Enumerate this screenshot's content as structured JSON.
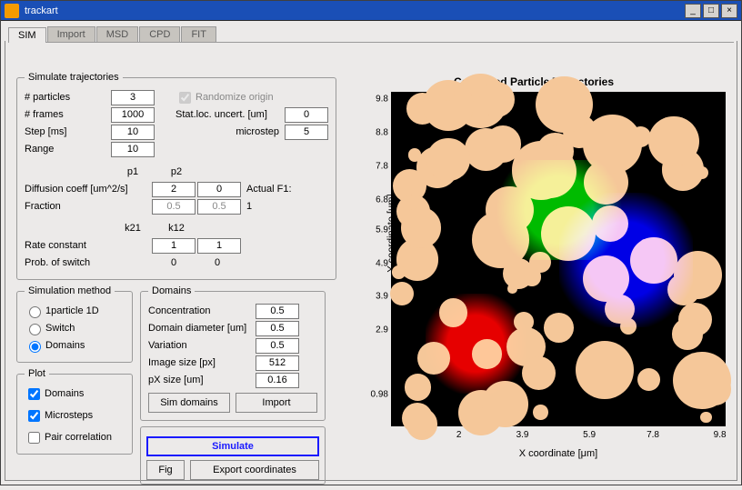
{
  "window": {
    "title": "trackart"
  },
  "tabs": [
    "SIM",
    "Import",
    "MSD",
    "CPD",
    "FIT"
  ],
  "activeTab": 0,
  "panels": {
    "simTraj": {
      "legend": "Simulate trajectories",
      "nparticles_label": "# particles",
      "nparticles": "3",
      "nframes_label": "# frames",
      "nframes": "1000",
      "step_label": "Step [ms]",
      "step": "10",
      "range_label": "Range",
      "range": "10",
      "rand_label": "Randomize origin",
      "stat_label": "Stat.loc. uncert. [um]",
      "stat": "0",
      "micro_label": "microstep",
      "micro": "5",
      "p1": "p1",
      "p2": "p2",
      "diff_label": "Diffusion coeff [um^2/s]",
      "diff_p1": "2",
      "diff_p2": "0",
      "af1_label": "Actual F1:",
      "af1_val": "1",
      "frac_label": "Fraction",
      "frac_p1": "0.5",
      "frac_p2": "0.5",
      "k21": "k21",
      "k12": "k12",
      "rate_label": "Rate constant",
      "rate_k21": "1",
      "rate_k12": "1",
      "psw_label": "Prob. of switch",
      "psw_k21": "0",
      "psw_k12": "0"
    },
    "method": {
      "legend": "Simulation method",
      "opt1": "1particle 1D",
      "opt2": "Switch",
      "opt3": "Domains",
      "selected": "Domains"
    },
    "domains": {
      "legend": "Domains",
      "conc_label": "Concentration",
      "conc": "0.5",
      "diam_label": "Domain diameter [um]",
      "diam": "0.5",
      "var_label": "Variation",
      "var": "0.5",
      "isize_label": "Image size [px]",
      "isize": "512",
      "psize_label": "pX size [um]",
      "psize": "0.16",
      "sim_btn": "Sim domains",
      "import_btn": "Import"
    },
    "plot": {
      "legend": "Plot",
      "domains": "Domains",
      "micro": "Microsteps",
      "pair": "Pair correlation"
    },
    "actions": {
      "simulate": "Simulate",
      "fig": "Fig",
      "export": "Export coordinates"
    }
  },
  "chart_data": {
    "type": "scatter",
    "title": "Combined Particle Trajectories",
    "xlabel": "X coordinate [μm]",
    "ylabel": "Y coordinate [μm]",
    "xticks": [
      2,
      3.9,
      5.9,
      7.8,
      9.8
    ],
    "yticks": [
      0.98,
      2.9,
      3.9,
      4.9,
      5.9,
      6.8,
      7.8,
      8.8,
      9.8
    ],
    "xlim": [
      0,
      10
    ],
    "ylim": [
      0,
      10
    ],
    "series": [
      {
        "name": "domains",
        "color": "#f5c799",
        "note": "circular obstacle regions, ~60 blobs of varying radius"
      },
      {
        "name": "particle1",
        "color": "#ff0000",
        "note": "dense random-walk cluster lower-left region approx x 1-4 y 1-4"
      },
      {
        "name": "particle2",
        "color": "#00d000",
        "note": "dense random-walk cluster upper-center region approx x 3-7 y 5-8"
      },
      {
        "name": "particle3",
        "color": "#0000ff",
        "note": "dense random-walk cluster center-right region approx x 5-9 y 3-7"
      }
    ]
  }
}
